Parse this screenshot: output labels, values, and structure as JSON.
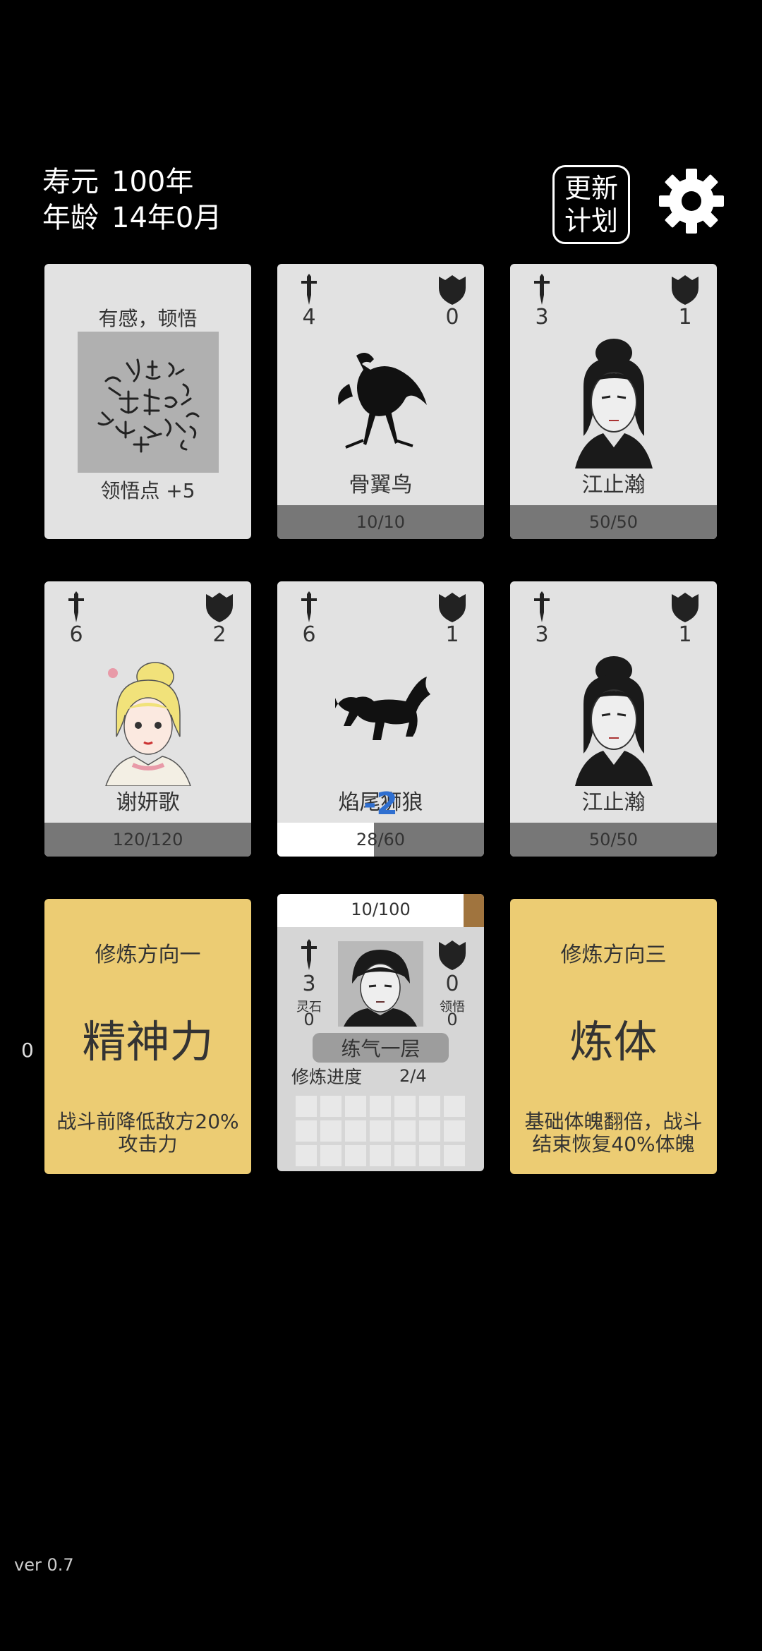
{
  "header": {
    "lifespan_label": "寿元",
    "lifespan_value": "100年",
    "age_label": "年龄",
    "age_value": "14年0月",
    "update_btn_line1": "更新",
    "update_btn_line2": "计划",
    "settings_icon": "gear-icon"
  },
  "cards": [
    {
      "type": "event",
      "title": "有感，顿悟",
      "footer": "领悟点  +5",
      "image": "enlightenment-calligraphy"
    },
    {
      "type": "enemy",
      "name": "骨翼鸟",
      "atk": "4",
      "def": "0",
      "hp": "10/10",
      "hp_fraction": 1.0,
      "image": "bone-wing-bird"
    },
    {
      "type": "ally",
      "name": "江止瀚",
      "atk": "3",
      "def": "1",
      "hp": "50/50",
      "hp_fraction": 1.0,
      "image": "jiang-zhihan"
    },
    {
      "type": "ally",
      "name": "谢妍歌",
      "atk": "6",
      "def": "2",
      "hp": "120/120",
      "hp_fraction": 1.0,
      "image": "xie-yange"
    },
    {
      "type": "enemy",
      "name": "焰尾狮狼",
      "atk": "6",
      "def": "1",
      "hp": "28/60",
      "hp_fraction": 0.467,
      "damage": "-2",
      "image": "flame-tail-lion-wolf"
    },
    {
      "type": "ally",
      "name": "江止瀚",
      "atk": "3",
      "def": "1",
      "hp": "50/50",
      "hp_fraction": 1.0,
      "image": "jiang-zhihan"
    }
  ],
  "cultivation": [
    {
      "title": "修炼方向一",
      "big": "精神力",
      "desc_line1": "战斗前降低敌方20%",
      "desc_line2": "攻击力"
    },
    {
      "title": "修炼方向三",
      "big": "炼体",
      "desc_line1": "基础体魄翻倍，战斗",
      "desc_line2": "结束恢复40%体魄"
    }
  ],
  "player": {
    "exp": "10/100",
    "exp_fraction": 0.1,
    "atk": "3",
    "def": "0",
    "spirit_stone_label": "灵石",
    "spirit_stone_value": "0",
    "insight_label": "领悟",
    "insight_value": "0",
    "realm": "练气一层",
    "progress_label": "修炼进度",
    "progress_value": "2/4"
  },
  "side_counter": "0",
  "version": "ver 0.7",
  "colors": {
    "background": "#000000",
    "card": "#e2e2e2",
    "cultivation_card": "#eccc73",
    "hp_bar": "#777777",
    "damage": "#2f6fd0"
  }
}
